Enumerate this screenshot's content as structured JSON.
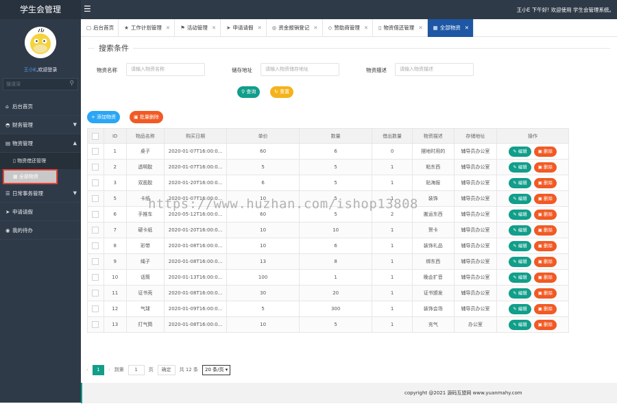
{
  "app": {
    "title": "学生会管理",
    "user_name": "王小E",
    "welcome_suffix": ",欢迎登录"
  },
  "colors": {
    "sidebar": "#2f3a48",
    "accent": "#119e8a",
    "tab_active": "#1d57a5",
    "danger": "#f15a24",
    "warning": "#f5b31b",
    "primary": "#2aa6f5"
  },
  "topbar": {
    "greeting": "王小E 下午好! 欢迎使用 学生会管理系统。",
    "menu_icon": "hamburger-icon"
  },
  "sidebar": {
    "search_placeholder": "搜请深",
    "items": [
      {
        "label": "后台首页",
        "icon": "home-icon",
        "arrow": ""
      },
      {
        "label": "财务管理",
        "icon": "finance-icon",
        "arrow": "▼"
      },
      {
        "label": "物资管理",
        "icon": "box-icon",
        "arrow": "▲"
      },
      {
        "label": "日常事务管理",
        "icon": "list-icon",
        "arrow": "▼"
      },
      {
        "label": "申请请假",
        "icon": "send-icon",
        "arrow": ""
      },
      {
        "label": "我的待办",
        "icon": "todo-icon",
        "arrow": ""
      }
    ],
    "sub_items": [
      {
        "label": "物资借还管理"
      },
      {
        "label": "全部物资"
      }
    ]
  },
  "tabs": [
    {
      "label": "后台首页",
      "icon": "▢",
      "closable": false
    },
    {
      "label": "工作计划管理",
      "icon": "★",
      "closable": true
    },
    {
      "label": "活动管理",
      "icon": "⚑",
      "closable": true
    },
    {
      "label": "申请请假",
      "icon": "➤",
      "closable": true
    },
    {
      "label": "资金报销登记",
      "icon": "◎",
      "closable": true
    },
    {
      "label": "赞助商管理",
      "icon": "◇",
      "closable": true
    },
    {
      "label": "物资借还管理",
      "icon": "▯",
      "closable": true
    },
    {
      "label": "全部物资",
      "icon": "▦",
      "closable": true,
      "active": true
    }
  ],
  "search": {
    "legend": "搜索条件",
    "name_label": "物资名称",
    "name_placeholder": "请输入物资名称",
    "addr_label": "储存地址",
    "addr_placeholder": "请输入物资储存地址",
    "desc_label": "物资描述",
    "desc_placeholder": "请输入物资描述",
    "query_label": "查询",
    "reset_label": "重置"
  },
  "toolbar": {
    "add_label": "添加物资",
    "batch_delete_label": "批量删除"
  },
  "table": {
    "headers": [
      "ID",
      "物品名称",
      "购买日期",
      "单价",
      "数量",
      "借出数量",
      "物资描述",
      "存储地址",
      "操作"
    ],
    "edit_label": "编辑",
    "delete_label": "删除",
    "rows": [
      [
        "1",
        "桌子",
        "2020-01-07T16:00:0...",
        "60",
        "6",
        "0",
        "摆地时用的",
        "辅导员办公室"
      ],
      [
        "2",
        "透明胶",
        "2020-01-07T16:00:0...",
        "5",
        "5",
        "1",
        "粘东西",
        "辅导员办公室"
      ],
      [
        "3",
        "双面胶",
        "2020-01-20T16:00:0...",
        "6",
        "5",
        "1",
        "贴海报",
        "辅导员办公室"
      ],
      [
        "5",
        "卡纸",
        "2020-01-07T16:00:0...",
        "10",
        "5",
        "1",
        "装饰",
        "辅导员办公室"
      ],
      [
        "6",
        "手推车",
        "2020-05-12T16:00:0...",
        "60",
        "5",
        "2",
        "搬运东西",
        "辅导员办公室"
      ],
      [
        "7",
        "硬卡纸",
        "2020-01-20T16:00:0...",
        "10",
        "10",
        "1",
        "贺卡",
        "辅导员办公室"
      ],
      [
        "8",
        "彩带",
        "2020-01-08T16:00:0...",
        "10",
        "6",
        "1",
        "装饰礼品",
        "辅导员办公室"
      ],
      [
        "9",
        "绳子",
        "2020-01-08T16:00:0...",
        "13",
        "8",
        "1",
        "绑东西",
        "辅导员办公室"
      ],
      [
        "10",
        "话筒",
        "2020-01-13T16:00:0...",
        "100",
        "1",
        "1",
        "晚会扩音",
        "辅导员办公室"
      ],
      [
        "11",
        "证书壳",
        "2020-01-08T16:00:0...",
        "30",
        "20",
        "1",
        "证书颁发",
        "辅导员办公室"
      ],
      [
        "12",
        "气球",
        "2020-01-09T16:00:0...",
        "5",
        "300",
        "1",
        "装饰会场",
        "辅导员办公室"
      ],
      [
        "13",
        "打气筒",
        "2020-01-08T16:00:0...",
        "10",
        "5",
        "1",
        "充气",
        "办公室"
      ]
    ]
  },
  "pager": {
    "current": "1",
    "goto_label": "到第",
    "page_input": "1",
    "page_unit": "页",
    "confirm": "确定",
    "total": "共 12 条",
    "page_size": "20 条/页"
  },
  "footer": {
    "text": "copyright @2021 源码互盟网  www.yuanmahy.com"
  },
  "watermark": "https://www.huzhan.com/ishop13808"
}
